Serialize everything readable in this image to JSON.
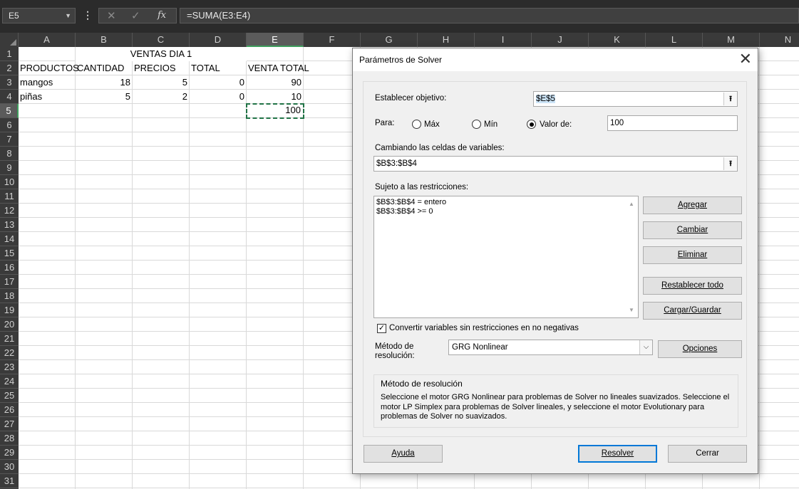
{
  "formula_bar": {
    "name_box": "E5",
    "cancel_icon": "✕",
    "enter_icon": "✓",
    "fx_label": "fx",
    "formula": "=SUMA(E3:E4)"
  },
  "sheet": {
    "columns": [
      "A",
      "B",
      "C",
      "D",
      "E",
      "F",
      "G",
      "H",
      "I",
      "J",
      "K",
      "L",
      "M",
      "N"
    ],
    "selected_column": "E",
    "rows": [
      "1",
      "2",
      "3",
      "4",
      "5",
      "6",
      "7",
      "8",
      "9",
      "10",
      "11",
      "12",
      "13",
      "14",
      "15",
      "16",
      "17",
      "18",
      "19",
      "20",
      "21",
      "22",
      "23",
      "24",
      "25",
      "26",
      "27",
      "28",
      "29",
      "30",
      "31"
    ],
    "selected_row": "5",
    "title": "VENTAS DIA 1",
    "headers": [
      "PRODUCTOS",
      "CANTIDAD",
      "PRECIOS",
      "TOTAL",
      "VENTA TOTAL"
    ],
    "data_rows": [
      {
        "producto": "mangos",
        "cantidad": "18",
        "precio": "5",
        "total": "0",
        "venta_total": "90"
      },
      {
        "producto": "piñas",
        "cantidad": "5",
        "precio": "2",
        "total": "0",
        "venta_total": "10"
      }
    ],
    "e5_value": "100"
  },
  "dialog": {
    "title": "Parámetros de Solver",
    "close_icon": "✕",
    "objective_label": "Establecer objetivo:",
    "objective_value": "$E$5",
    "ref_icon": "⭱",
    "para_label": "Para:",
    "max_label": "Máx",
    "min_label": "Mín",
    "value_of_label": "Valor de:",
    "value_of": "100",
    "selected_option": "valor",
    "changing_label": "Cambiando las celdas de variables:",
    "changing_value": "$B$3:$B$4",
    "constraints_label": "Sujeto a las restricciones:",
    "constraints": [
      "$B$3:$B$4 = entero",
      "$B$3:$B$4 >= 0"
    ],
    "buttons": {
      "add": "Agregar",
      "change": "Cambiar",
      "delete": "Eliminar",
      "reset": "Restablecer todo",
      "load_save": "Cargar/Guardar",
      "options": "Opciones",
      "help": "Ayuda",
      "solve": "Resolver",
      "close": "Cerrar"
    },
    "nonneg_label": "Convertir variables sin restricciones en no negativas",
    "nonneg_checked": "✓",
    "method_label_line1": "Método de",
    "method_label_line2": "resolución:",
    "method_value": "GRG Nonlinear",
    "method_options": [
      "GRG Nonlinear"
    ],
    "description_title": "Método de resolución",
    "description_text": "Seleccione el motor GRG Nonlinear para problemas de Solver no lineales suavizados. Seleccione el motor LP Simplex para problemas de Solver lineales, y seleccione el motor Evolutionary para problemas de Solver no suavizados."
  }
}
